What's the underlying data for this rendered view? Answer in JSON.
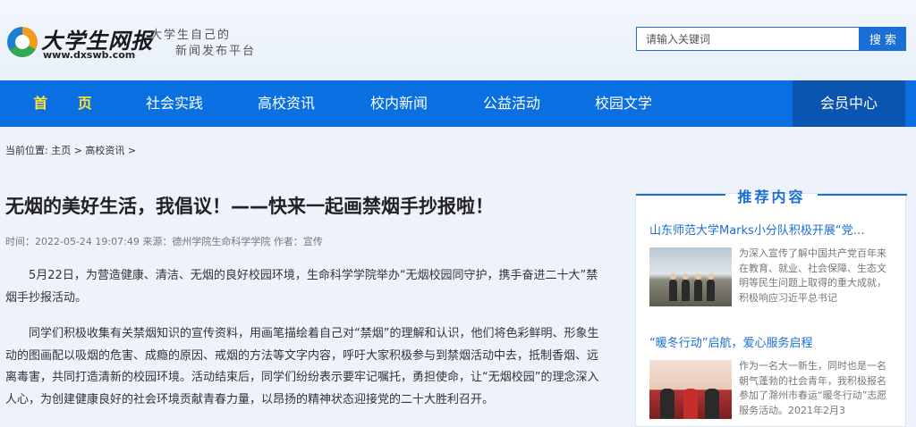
{
  "header": {
    "logo_name": "大学生网报",
    "logo_url": "www.dxswb.com",
    "slogan_line1": "大学生自己的",
    "slogan_line2": "新闻发布平台",
    "search_placeholder": "请输入关键词",
    "search_button": "搜 索"
  },
  "nav": {
    "items": [
      {
        "label": "首 页"
      },
      {
        "label": "社会实践"
      },
      {
        "label": "高校资讯"
      },
      {
        "label": "校内新闻"
      },
      {
        "label": "公益活动"
      },
      {
        "label": "校园文学"
      }
    ],
    "member": "会员中心"
  },
  "breadcrumb": "当前位置: 主页 > 高校资讯 >",
  "article": {
    "title": "无烟的美好生活，我倡议！——快来一起画禁烟手抄报啦！",
    "meta": "时间：2022-05-24 19:07:49 来源：德州学院生命科学学院 作者：宣传",
    "paragraphs": [
      "5月22日，为营造健康、清洁、无烟的良好校园环境，生命科学学院举办“无烟校园同守护，携手奋进二十大”禁烟手抄报活动。",
      "同学们积极收集有关禁烟知识的宣传资料，用画笔描绘着自己对“禁烟”的理解和认识，他们将色彩鲜明、形象生动的图画配以吸烟的危害、成瘾的原因、戒烟的方法等文字内容，呼吁大家积极参与到禁烟活动中去，抵制香烟、远离毒害，共同打造清新的校园环境。活动结束后，同学们纷纷表示要牢记嘱托，勇担使命，让“无烟校园”的理念深入人心，为创建健康良好的社会环境贡献青春力量，以昂扬的精神状态迎接党的二十大胜利召开。"
    ]
  },
  "sidebar": {
    "title": "推荐内容",
    "items": [
      {
        "link": "山东师范大学Marks小分队积极开展“党…",
        "desc": "为深入宣传了解中国共产党百年来在教育、就业、社会保障、生态文明等民生问题上取得的重大成就，积极响应习近平总书记"
      },
      {
        "link": "“暖冬行动”启航，爱心服务启程",
        "desc": "作为一名大一新生，同时也是一名朝气蓬勃的社会青年，我积极报名参加了滁州市春运“暖冬行动”志愿服务活动。2021年2月3"
      }
    ]
  }
}
